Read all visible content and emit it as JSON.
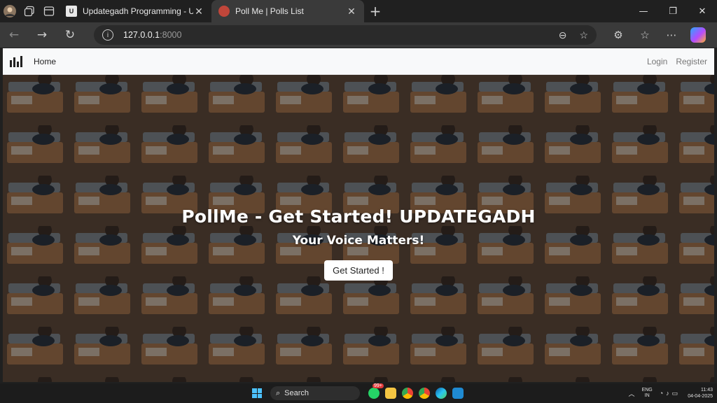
{
  "browser": {
    "tabs": [
      {
        "title": "Updategadh Programming - Upd",
        "active": false
      },
      {
        "title": "Poll Me | Polls List",
        "active": true
      }
    ],
    "url_host": "127.0.0.1",
    "url_port": ":8000"
  },
  "navbar": {
    "home_label": "Home",
    "login_label": "Login",
    "register_label": "Register"
  },
  "hero": {
    "title": "PollMe - Get Started! UPDATEGADH",
    "subtitle": "Your Voice Matters!",
    "button_label": "Get Started !"
  },
  "taskbar": {
    "search_label": "Search",
    "whatsapp_badge": "99+",
    "lang_line1": "ENG",
    "lang_line2": "IN",
    "time": "11:43",
    "date": "04-04-2025"
  },
  "colors": {
    "accent_blue": "#4cc2ff",
    "hero_overlay": "#6b5544"
  }
}
